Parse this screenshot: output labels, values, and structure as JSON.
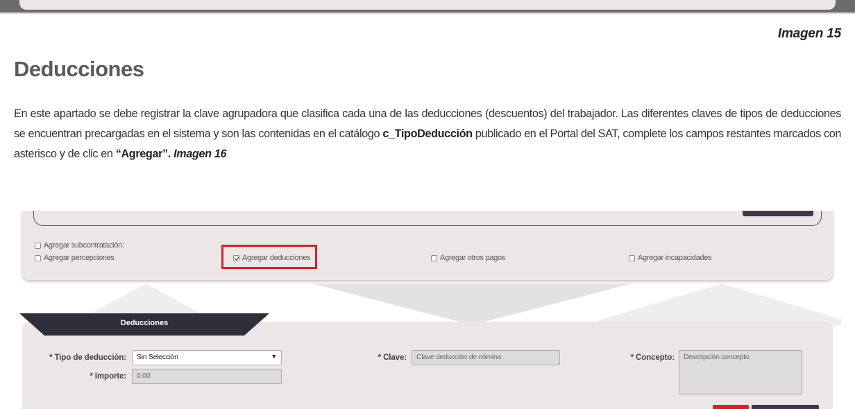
{
  "caption_top": "Imagen 15",
  "section": {
    "title": "Deducciones",
    "paragraph": {
      "part1": "En este apartado se debe registrar la clave agrupadora que clasifica cada una de las deducciones (descuentos) del trabajador. Las diferentes claves de tipos de deducciones se encuentran precargadas en el sistema y son las contenidas en el catálogo ",
      "catalog": "c_TipoDeducción",
      "part2": " publicado en el Portal del SAT, complete los campos restantes marcados con asterisco y de clic en ",
      "button_ref": "“Agregar”.",
      "image_ref": "Imagen 16"
    }
  },
  "screenshot": {
    "checkboxes": {
      "subcontratacion": "Agregar subcontratación:",
      "percepciones": "Agregar percepciones",
      "deducciones": "Agregar deducciones",
      "otros_pagos": "Agregar otros pagos",
      "incapacidades": "Agregar incapacidades"
    },
    "tab_label": "Deducciones",
    "form": {
      "tipo_label": "* Tipo de deducción:",
      "tipo_value": "Sin Selección",
      "clave_label": "* Clave:",
      "clave_placeholder": "Clave deducción de nómina",
      "concepto_label": "* Concepto:",
      "concepto_placeholder": "Descripción concepto",
      "importe_label": "* Importe:",
      "importe_value": "0.00"
    }
  }
}
